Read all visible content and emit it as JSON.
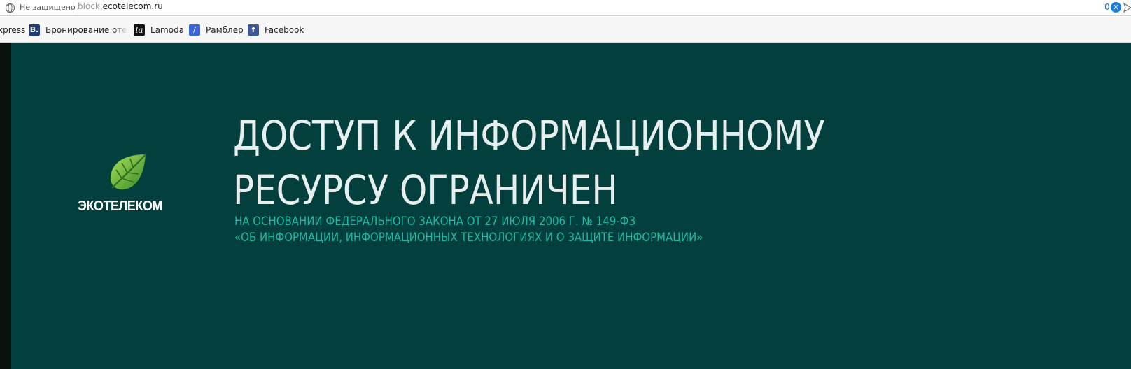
{
  "addressbar": {
    "security_label": "Не защищено",
    "url_prefix": "block.",
    "url_host": "ecotelecom.ru",
    "count": "0"
  },
  "bookmarks": [
    {
      "label": "xpress",
      "icon": "none"
    },
    {
      "label": "Бронирование отелей",
      "icon": "booking-icon",
      "glyph": "B."
    },
    {
      "label": "Lamoda",
      "icon": "lamoda-icon",
      "glyph": "la"
    },
    {
      "label": "Рамблер",
      "icon": "rambler-icon",
      "glyph": "/"
    },
    {
      "label": "Facebook",
      "icon": "facebook-icon",
      "glyph": "f"
    }
  ],
  "page": {
    "brand": "ЭКОТЕЛЕКОМ",
    "headline_line1": "ДОСТУП К ИНФОРМАЦИОННОМУ",
    "headline_line2": "РЕСУРСУ ОГРАНИЧЕН",
    "subtitle_line1": "НА ОСНОВАНИИ ФЕДЕРАЛЬНОГО ЗАКОНА ОТ 27 ИЮЛЯ 2006 Г. № 149-ФЗ",
    "subtitle_line2": "«ОБ ИНФОРМАЦИИ, ИНФОРМАЦИОННЫХ ТЕХНОЛОГИЯХ И О ЗАЩИТЕ ИНФОРМАЦИИ»"
  },
  "colors": {
    "page_background": "#023f3d",
    "headline": "#e6efee",
    "subtitle": "#20b8a5",
    "leaf_light": "#8fd14f",
    "leaf_dark": "#3d8c2a"
  }
}
